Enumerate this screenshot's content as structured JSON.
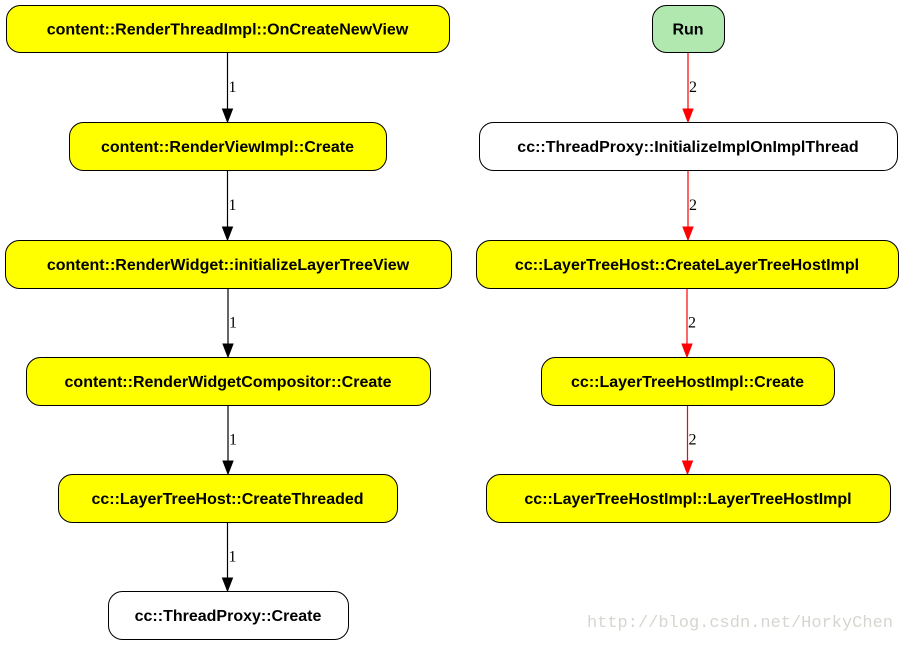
{
  "colors": {
    "yellow": "#ffff00",
    "white": "#ffffff",
    "green": "#b0e8b0",
    "black_edge": "#000000",
    "red_edge": "#ff0000"
  },
  "nodes": [
    {
      "id": "n1",
      "label": "content::RenderThreadImpl::OnCreateNewView",
      "fill": "#ffff00"
    },
    {
      "id": "n2",
      "label": "content::RenderViewImpl::Create",
      "fill": "#ffff00"
    },
    {
      "id": "n3",
      "label": "content::RenderWidget::initializeLayerTreeView",
      "fill": "#ffff00"
    },
    {
      "id": "n4",
      "label": "content::RenderWidgetCompositor::Create",
      "fill": "#ffff00"
    },
    {
      "id": "n5",
      "label": "cc::LayerTreeHost::CreateThreaded",
      "fill": "#ffff00"
    },
    {
      "id": "n6",
      "label": "cc::ThreadProxy::Create",
      "fill": "#ffffff"
    },
    {
      "id": "r0",
      "label": "Run",
      "fill": "#b0e8b0"
    },
    {
      "id": "r1",
      "label": "cc::ThreadProxy::InitializeImplOnImplThread",
      "fill": "#ffffff"
    },
    {
      "id": "r2",
      "label": "cc::LayerTreeHost::CreateLayerTreeHostImpl",
      "fill": "#ffff00"
    },
    {
      "id": "r3",
      "label": "cc::LayerTreeHostImpl::Create",
      "fill": "#ffff00"
    },
    {
      "id": "r4",
      "label": "cc::LayerTreeHostImpl::LayerTreeHostImpl",
      "fill": "#ffff00"
    }
  ],
  "edges": [
    {
      "from": "n1",
      "to": "n2",
      "label": "1",
      "color": "#000000"
    },
    {
      "from": "n2",
      "to": "n3",
      "label": "1",
      "color": "#000000"
    },
    {
      "from": "n3",
      "to": "n4",
      "label": "1",
      "color": "#000000"
    },
    {
      "from": "n4",
      "to": "n5",
      "label": "1",
      "color": "#000000"
    },
    {
      "from": "n5",
      "to": "n6",
      "label": "1",
      "color": "#000000"
    },
    {
      "from": "r0",
      "to": "r1",
      "label": "2",
      "color": "#ff0000"
    },
    {
      "from": "r1",
      "to": "r2",
      "label": "2",
      "color": "#ff0000"
    },
    {
      "from": "r2",
      "to": "r3",
      "label": "2",
      "color": "#ff0000"
    },
    {
      "from": "r3",
      "to": "r4",
      "label": "2",
      "color": "#ff0000"
    }
  ],
  "watermark": "http://blog.csdn.net/HorkyChen"
}
